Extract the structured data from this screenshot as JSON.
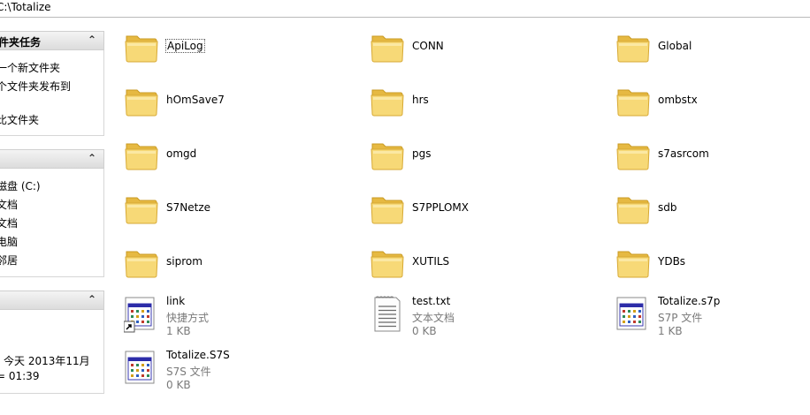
{
  "address": {
    "path": "C:\\Totalize"
  },
  "left_pane": {
    "tasks": {
      "title": "件夹任务",
      "items": [
        "一个新文件夹",
        "个文件夹发布到",
        "比文件夹"
      ]
    },
    "places": {
      "items": [
        "磁盘 (C:)",
        "文档",
        "文档",
        "电脑",
        "邻居"
      ]
    },
    "details": {
      "line1": "今天 2013年11月",
      "line2": "= 01:39"
    }
  },
  "folders": [
    "ApiLog",
    "CONN",
    "Global",
    "hOmSave7",
    "hrs",
    "ombstx",
    "omgd",
    "pgs",
    "s7asrcom",
    "S7Netze",
    "S7PPLOMX",
    "sdb",
    "siprom",
    "XUTILS",
    "YDBs"
  ],
  "files": [
    {
      "name": "link",
      "type": "快捷方式",
      "size": "1 KB",
      "icon": "shortcut-app-icon"
    },
    {
      "name": "test.txt",
      "type": "文本文档",
      "size": "0 KB",
      "icon": "text-document-icon"
    },
    {
      "name": "Totalize.s7p",
      "type": "S7P 文件",
      "size": "1 KB",
      "icon": "app-window-icon"
    },
    {
      "name": "Totalize.S7S",
      "type": "S7S 文件",
      "size": "0 KB",
      "icon": "app-window-icon"
    }
  ],
  "colors": {
    "folder": "#f4d26b",
    "folder_dark": "#d9a92c",
    "section_header": "#e4e4e4"
  }
}
